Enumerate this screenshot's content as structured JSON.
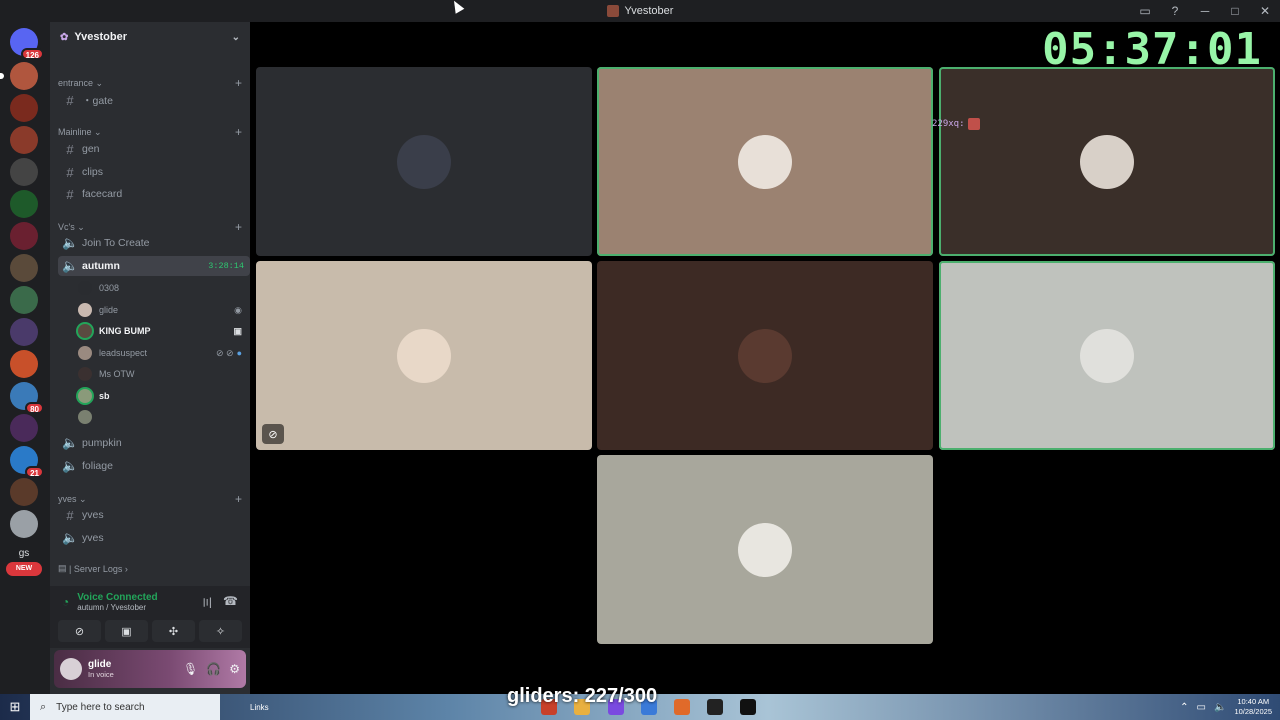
{
  "window": {
    "title": "Yvestober"
  },
  "clock": "05:37:01",
  "rail": {
    "home_badge": "126",
    "badges": [
      "80",
      "21"
    ],
    "gs_label": "gs",
    "new_label": "NEW"
  },
  "sidebar": {
    "server_name": "Yvestober",
    "categories": {
      "entrance": "entrance",
      "mainline": "Mainline",
      "vcs": "Vc's",
      "yves": "yves",
      "server_logs": "| Server Logs"
    },
    "channels": {
      "gate": "・gate",
      "gen": "gen",
      "clips": "clips",
      "facecard": "facecard",
      "join_to_create": "Join To Create",
      "autumn": "autumn",
      "autumn_timer": "3:28:14",
      "pumpkin": "pumpkin",
      "foliage": "foliage",
      "yves_text": "yves",
      "yves_voice": "yves"
    },
    "members": [
      "0308",
      "glide",
      "KING BUMP",
      "leadsuspect",
      "Ms OTW",
      "sb",
      ""
    ]
  },
  "voice_panel": {
    "status": "Voice Connected",
    "location": "autumn / Yvestober"
  },
  "user_panel": {
    "name": "glide",
    "status": "In voice"
  },
  "tiles": {
    "colors": [
      "#2b2d31",
      "#9b8271",
      "#3a2f29",
      "#c8bbab",
      "#3d2a24",
      "#bfc2bd",
      "#a8a79c"
    ],
    "speaking": [
      false,
      true,
      true,
      false,
      false,
      true,
      false
    ]
  },
  "overlay": {
    "label": "229xq:"
  },
  "taskbar": {
    "search_placeholder": "Type here to search",
    "links": "Links",
    "time": "10:40 AM",
    "date": "10/28/2025"
  },
  "stream_overlay": "gliders: 227/300"
}
